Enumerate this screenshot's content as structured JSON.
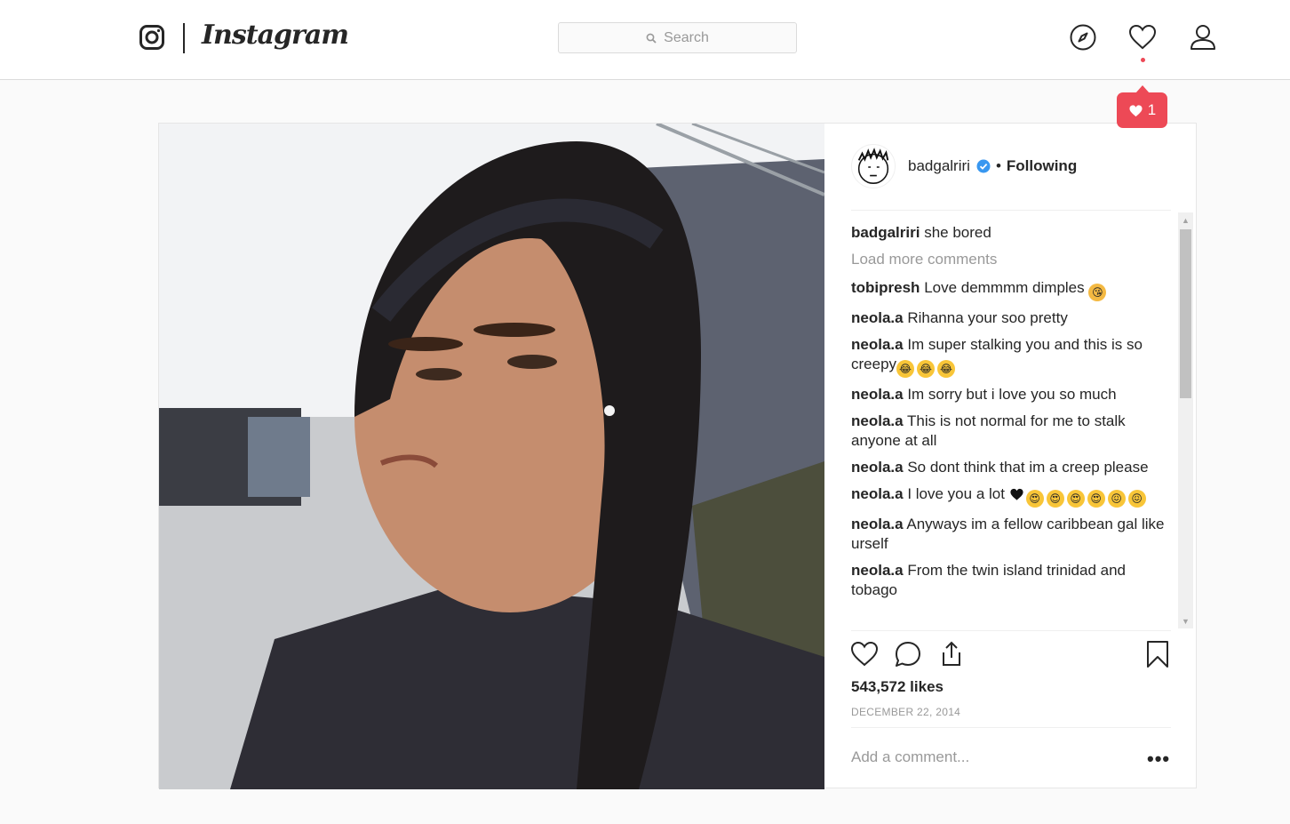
{
  "nav": {
    "brand": "Instagram",
    "search_placeholder": "Search",
    "icons": [
      "instagram-glyph-icon",
      "compass-icon",
      "heart-icon",
      "user-icon"
    ],
    "notification_count": "1"
  },
  "post": {
    "username": "badgalriri",
    "verified": true,
    "separator": "•",
    "follow_status": "Following",
    "caption": {
      "user": "badgalriri",
      "text": "she bored"
    },
    "load_more": "Load more comments",
    "comments": [
      {
        "user": "tobipresh",
        "text": "Love demmmm dimples",
        "emoji": [
          "kiss"
        ]
      },
      {
        "user": "neola.a",
        "text": "Rihanna your soo pretty",
        "emoji": []
      },
      {
        "user": "neola.a",
        "text": "Im super stalking you and this is so creepy",
        "emoji": [
          "joy",
          "joy",
          "joy"
        ]
      },
      {
        "user": "neola.a",
        "text": "Im sorry but i love you so much",
        "emoji": []
      },
      {
        "user": "neola.a",
        "text": "This is not normal for me to stalk anyone at all",
        "emoji": []
      },
      {
        "user": "neola.a",
        "text": "So dont think that im a creep please",
        "emoji": []
      },
      {
        "user": "neola.a",
        "text": "I love you a lot",
        "emoji": [
          "black-heart",
          "heart-eyes",
          "heart-eyes",
          "heart-eyes",
          "heart-eyes",
          "confounded",
          "confounded"
        ]
      },
      {
        "user": "neola.a",
        "text": "Anyways im a fellow caribbean gal like urself",
        "emoji": []
      },
      {
        "user": "neola.a",
        "text": "From the twin island trinidad and tobago",
        "emoji": []
      }
    ],
    "likes": "543,572 likes",
    "date": "DECEMBER 22, 2014",
    "add_comment_placeholder": "Add a comment...",
    "more_label": "•••"
  },
  "colors": {
    "notification": "#ed4956",
    "verified": "#3897f0",
    "muted": "#999999"
  }
}
